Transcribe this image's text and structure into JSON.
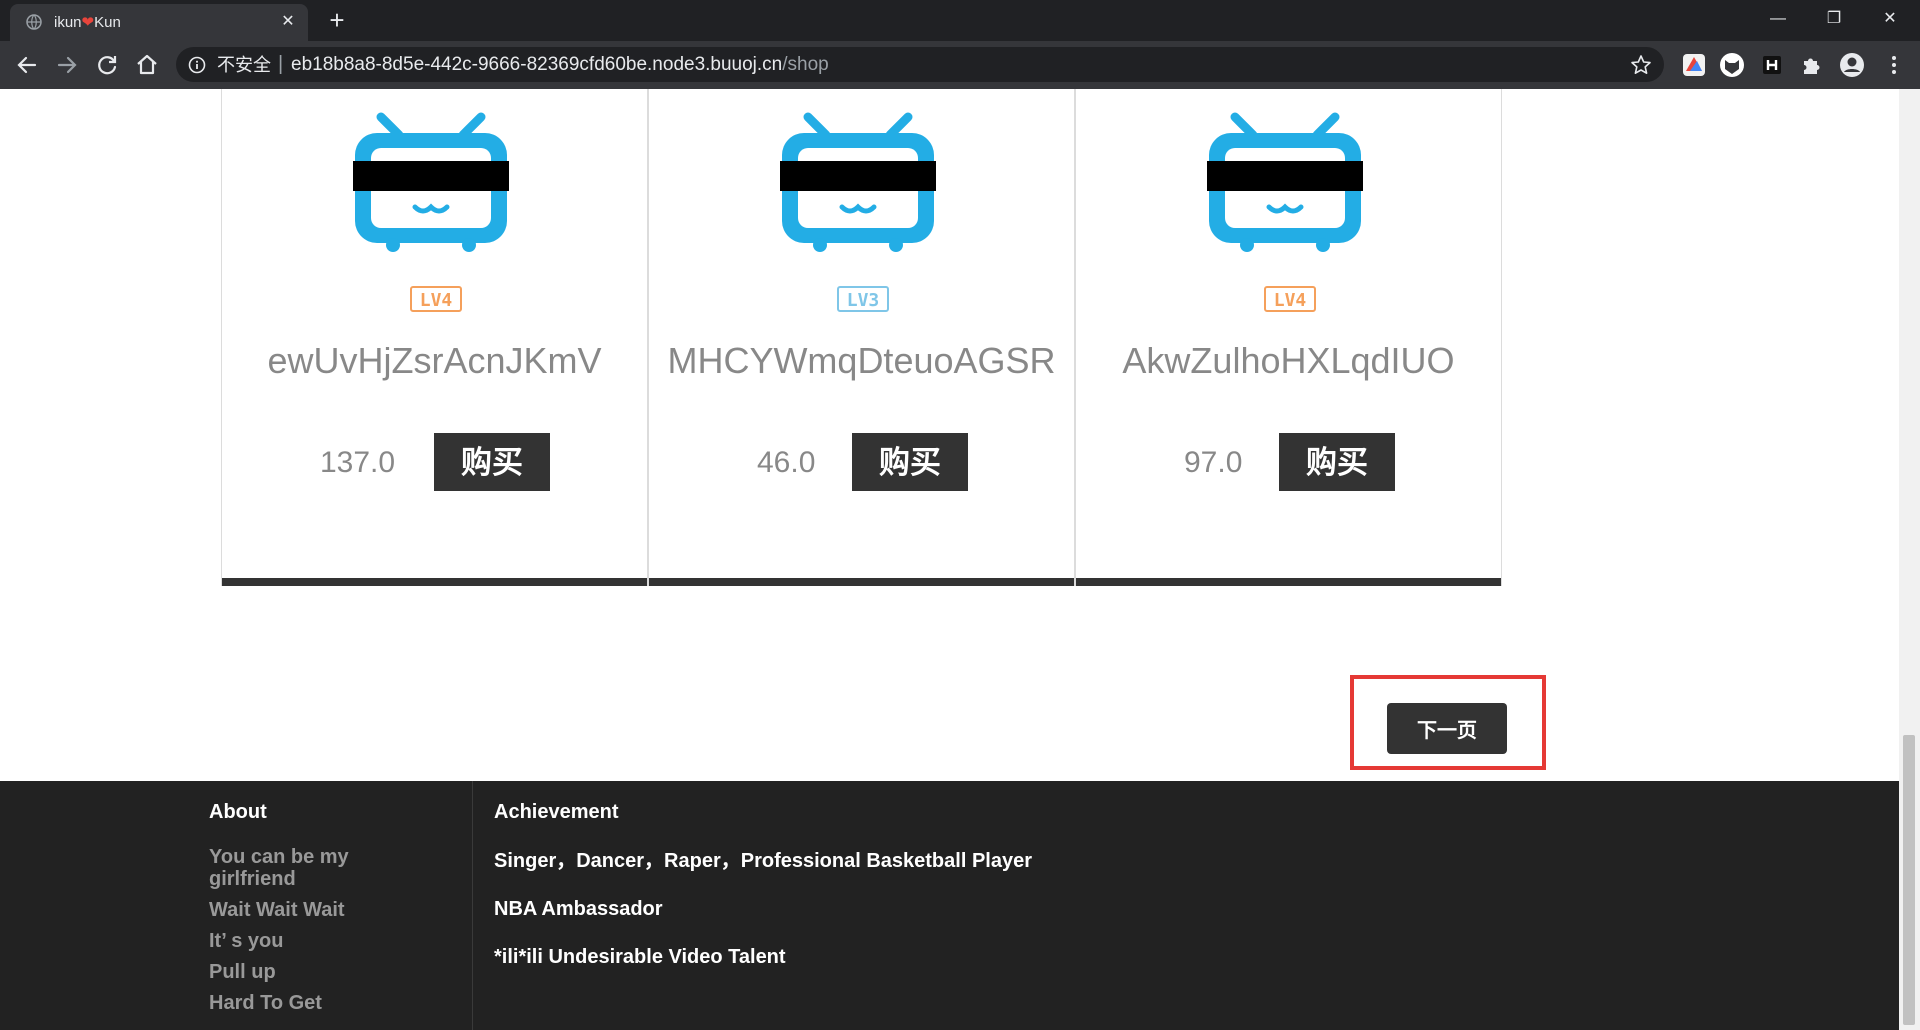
{
  "browser": {
    "tab": {
      "title_before": "ikun",
      "title_heart": "❤",
      "title_after": "Kun",
      "close": "✕"
    },
    "new_tab": "+",
    "window_controls": {
      "minimize": "—",
      "restore": "❐",
      "close": "✕"
    },
    "address": {
      "security_label": "不安全",
      "separator": "|",
      "host": "eb18b8a8-8d5e-442c-9666-82369cfd60be.node3.buuoj.cn",
      "path": "/shop"
    }
  },
  "products": [
    {
      "name": "ewUvHjZsrAcnJKmV",
      "level": 4,
      "price": "137.0",
      "buy_label": "购买"
    },
    {
      "name": "MHCYWmqDteuoAGSR",
      "level": 3,
      "price": "46.0",
      "buy_label": "购买"
    },
    {
      "name": "AkwZulhoHXLqdIUO",
      "level": 4,
      "price": "97.0",
      "buy_label": "购买"
    }
  ],
  "pagination": {
    "next_label": "下一页"
  },
  "footer": {
    "about": {
      "heading": "About",
      "items": [
        "You can be my girlfriend",
        "Wait Wait Wait",
        "It’ s you",
        "Pull up",
        "Hard To Get"
      ]
    },
    "achievement": {
      "heading": "Achievement",
      "items": [
        "Singer，Dancer，Raper，Professional Basketball Player",
        "NBA Ambassador",
        "*ili*ili Undesirable Video Talent"
      ]
    }
  },
  "colors": {
    "tv_blue": "#23ade5",
    "level4": "#f5a05b",
    "level3": "#7fc6e8",
    "button_dark": "#333333",
    "highlight_red": "#e53935"
  },
  "icons": {
    "tab_favicon": "globe-icon",
    "back": "arrow-left-icon",
    "forward": "arrow-right-icon",
    "reload": "reload-icon",
    "home": "home-icon",
    "info": "info-icon",
    "bookmark": "star-icon",
    "extensions": "puzzle-icon",
    "profile": "account-icon",
    "menu": "kebab-icon",
    "product_image": "tv-mascot-icon"
  }
}
